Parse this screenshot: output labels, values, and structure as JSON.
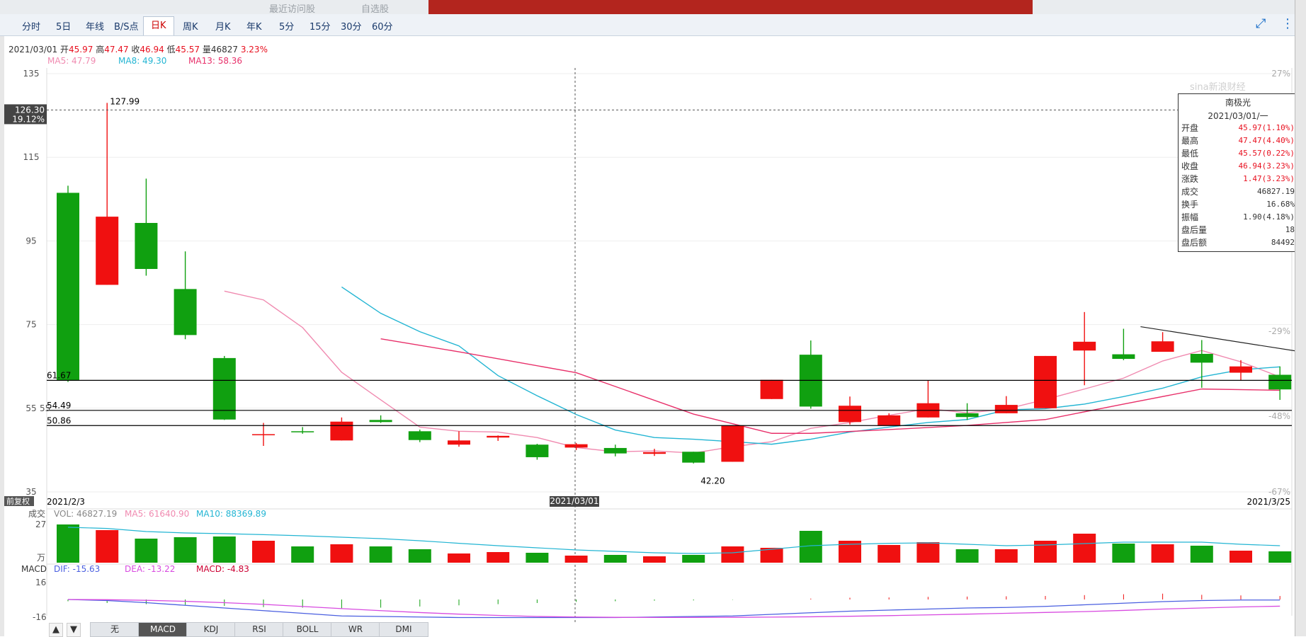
{
  "header": {
    "ghost_left": "最近访问股",
    "ghost_right": "自选股"
  },
  "tabs": [
    "分时",
    "5日",
    "年线",
    "B/S点",
    "日K",
    "周K",
    "月K",
    "年K",
    "5分",
    "15分",
    "30分",
    "60分"
  ],
  "active_tab": "日K",
  "icons": {
    "expand": "expand-icon",
    "more": "more-vertical-icon"
  },
  "info": {
    "date": "2021/03/01",
    "open_label": "开",
    "open": "45.97",
    "high_label": "高",
    "high": "47.47",
    "close_label": "收",
    "close": "46.94",
    "low_label": "低",
    "low": "45.57",
    "vol_label": "量",
    "vol": "46827",
    "chg": "3.23%"
  },
  "ma_text": {
    "ma5": "MA5: 47.79",
    "ma8": "MA8: 49.30",
    "ma13": "MA13: 58.36"
  },
  "colors": {
    "up": "#f01010",
    "down": "#10a010",
    "ma5": "#f08ab0",
    "ma8": "#23b5d3",
    "ma13": "#e8306a",
    "dif": "#4a5fe0",
    "dea": "#d84ae0"
  },
  "price_axis": {
    "left_ticks": [
      "135",
      "115",
      "95",
      "75",
      "55",
      "35"
    ],
    "right_ticks": [
      "27%",
      "-29%",
      "-48%",
      "-67%"
    ],
    "cursor_price": "126.30",
    "cursor_pct": "19.12%",
    "lines": [
      "61.67",
      "54.49",
      "50.86"
    ]
  },
  "watermark": "sina新浪财经",
  "tooltip": {
    "name": "南极光",
    "date": "2021/03/01/一",
    "rows": [
      {
        "label": "开盘",
        "value": "45.97(1.10%)",
        "red": true
      },
      {
        "label": "最高",
        "value": "47.47(4.40%)",
        "red": true
      },
      {
        "label": "最低",
        "value": "45.57(0.22%)",
        "red": true
      },
      {
        "label": "收盘",
        "value": "46.94(3.23%)",
        "red": true
      },
      {
        "label": "涨跌",
        "value": "1.47(3.23%)",
        "red": true
      },
      {
        "label": "成交",
        "value": "46827.19",
        "red": false
      },
      {
        "label": "换手",
        "value": "16.68%",
        "red": false
      },
      {
        "label": "振幅",
        "value": "1.90(4.18%)",
        "red": false
      },
      {
        "label": "盘后量",
        "value": "18",
        "red": false
      },
      {
        "label": "盘后额",
        "value": "84492",
        "red": false
      }
    ]
  },
  "annotations": {
    "max": "127.99",
    "min": "42.20"
  },
  "date_axis": {
    "left": "2021/2/3",
    "right": "2021/3/25",
    "cursor": "2021/03/01",
    "corner_label": "前复权"
  },
  "volume_panel": {
    "label": "成交",
    "vol_text": "VOL: 46827.19",
    "ma5_text": "MA5: 61640.90",
    "ma10_text": "MA10: 88369.89",
    "top_tick": "27",
    "unit": "万"
  },
  "macd_panel": {
    "label": "MACD",
    "dif_text": "DIF: -15.63",
    "dea_text": "DEA: -13.22",
    "macd_text": "MACD: -4.83",
    "ticks": [
      "16",
      "-16"
    ]
  },
  "subtabs": [
    "无",
    "MACD",
    "KDJ",
    "RSI",
    "BOLL",
    "WR",
    "DMI"
  ],
  "active_subtab": "MACD",
  "chart_data": {
    "type": "candlestick",
    "x": [
      "2021/2/3",
      "",
      "",
      "",
      "",
      "",
      "",
      "",
      "",
      "",
      "",
      "",
      "",
      "2021/03/01",
      "",
      "",
      "",
      "",
      "",
      "",
      "",
      "",
      "",
      "",
      "",
      "",
      "",
      "",
      "",
      "",
      "",
      "",
      "",
      "2021/3/25"
    ],
    "ohlc": [
      [
        106.5,
        108.2,
        61.3,
        61.7
      ],
      [
        84.5,
        128.0,
        84.5,
        100.8
      ],
      [
        99.3,
        109.9,
        86.7,
        88.3
      ],
      [
        83.5,
        92.5,
        71.5,
        72.5
      ],
      [
        67.0,
        67.5,
        52.2,
        52.3
      ],
      [
        48.8,
        51.5,
        46.0,
        48.8
      ],
      [
        49.5,
        50.5,
        48.9,
        49.3
      ],
      [
        47.3,
        52.8,
        47.3,
        51.8
      ],
      [
        52.2,
        53.3,
        51.5,
        51.7
      ],
      [
        49.5,
        49.9,
        46.9,
        47.4
      ],
      [
        46.3,
        49.5,
        45.8,
        47.3
      ],
      [
        48.0,
        48.5,
        47.2,
        48.4
      ],
      [
        46.3,
        46.5,
        42.7,
        43.3
      ],
      [
        45.6,
        46.7,
        45.0,
        46.4
      ],
      [
        45.5,
        46.3,
        43.5,
        44.2
      ],
      [
        44.1,
        45.3,
        43.6,
        44.5
      ],
      [
        44.6,
        44.6,
        41.8,
        42.0
      ],
      [
        42.2,
        50.9,
        42.2,
        50.9
      ],
      [
        57.2,
        61.8,
        57.2,
        61.8
      ],
      [
        67.8,
        71.2,
        54.9,
        55.4
      ],
      [
        51.7,
        57.8,
        51.1,
        55.6
      ],
      [
        50.9,
        53.8,
        50.9,
        53.3
      ],
      [
        52.8,
        61.6,
        52.8,
        56.2
      ],
      [
        53.8,
        56.2,
        52.2,
        52.9
      ],
      [
        53.8,
        57.9,
        53.8,
        55.8
      ],
      [
        55.0,
        67.5,
        55.0,
        67.5
      ],
      [
        68.8,
        78.0,
        60.5,
        70.9
      ],
      [
        67.9,
        74.0,
        66.5,
        66.8
      ],
      [
        68.5,
        73.2,
        68.5,
        71.0
      ],
      [
        68.0,
        71.3,
        59.9,
        65.9
      ],
      [
        63.5,
        66.5,
        61.6,
        65.0
      ],
      [
        63.0,
        65.0,
        57.0,
        59.5
      ]
    ],
    "ma5": [
      null,
      null,
      null,
      null,
      83.0,
      80.9,
      74.3,
      63.6,
      57.0,
      50.5,
      49.5,
      49.3,
      48.0,
      45.6,
      44.6,
      44.8,
      44.3,
      45.8,
      47.0,
      50.2,
      51.6,
      53.3,
      54.9,
      53.9,
      54.8,
      57.1,
      59.6,
      62.2,
      66.3,
      68.8,
      66.1,
      62.5
    ],
    "ma8": [
      null,
      null,
      null,
      null,
      null,
      null,
      null,
      84.0,
      77.7,
      73.3,
      69.9,
      62.8,
      58.0,
      53.5,
      49.8,
      48.0,
      47.6,
      47.0,
      46.4,
      47.6,
      49.3,
      50.5,
      51.6,
      52.3,
      54.6,
      54.9,
      56.0,
      57.8,
      59.8,
      62.5,
      64.2,
      64.9
    ],
    "ma13": [
      null,
      null,
      null,
      null,
      null,
      null,
      null,
      null,
      null,
      null,
      null,
      null,
      72.0,
      null,
      null,
      null,
      null,
      null,
      null,
      null,
      null,
      null,
      null,
      null,
      null,
      null,
      null,
      null,
      null,
      null,
      null,
      null
    ],
    "ma13_points": [
      [
        8,
        71.6
      ],
      [
        10,
        68.5
      ],
      [
        13,
        63.5
      ],
      [
        16,
        53.6
      ],
      [
        18,
        49.0
      ],
      [
        19,
        49.0
      ],
      [
        21,
        49.9
      ],
      [
        23,
        50.9
      ],
      [
        25,
        52.3
      ],
      [
        27,
        56.0
      ],
      [
        29,
        59.6
      ],
      [
        31,
        59.3
      ]
    ],
    "trendline": [
      [
        27,
        74.5
      ],
      [
        32,
        67.5
      ]
    ],
    "hlines": [
      61.67,
      54.49,
      50.86
    ],
    "ylim": [
      35,
      135
    ],
    "volume_wan": [
      27,
      23,
      17,
      18,
      18.5,
      15.5,
      11.5,
      13,
      11.5,
      9.5,
      6.5,
      7.5,
      7,
      5,
      5.5,
      4.5,
      5.5,
      11.5,
      10.5,
      22.5,
      15.5,
      12.5,
      14.5,
      9.5,
      9.5,
      15.5,
      20.5,
      13.5,
      13,
      12,
      8.5,
      8
    ],
    "volume_ma": [
      25.0,
      24.2,
      22.0,
      21.0,
      20.5,
      19.8,
      19.0,
      18.0,
      17.0,
      15.5,
      13.7,
      12.0,
      10.5,
      9.0,
      8.0,
      7.0,
      6.5,
      7.0,
      9.5,
      12.0,
      13.0,
      13.7,
      14.0,
      13.0,
      12.0,
      12.5,
      13.5,
      14.5,
      14.5,
      14.5,
      13.0,
      12.0
    ],
    "volume_ylim": [
      0,
      27
    ],
    "macd_hist": [
      -3,
      -6,
      -8,
      -9,
      -11,
      -13,
      -14,
      -15,
      -14,
      -12,
      -10,
      -8,
      -6,
      -4,
      -3,
      -2,
      -1.5,
      -0.5,
      0,
      1.5,
      3,
      3.5,
      4.5,
      5,
      5.5,
      6,
      7.5,
      9,
      10,
      8,
      7,
      6
    ],
    "dif": [
      0,
      -1,
      -3,
      -5.5,
      -8,
      -10.5,
      -13,
      -15.5,
      -16,
      -16.5,
      -17,
      -17,
      -17,
      -17,
      -17,
      -16.5,
      -16,
      -15.5,
      -14,
      -12.5,
      -11,
      -10,
      -9,
      -8,
      -7.5,
      -6.5,
      -5,
      -3.5,
      -2,
      -1,
      -0.5,
      -0.5
    ],
    "dea": [
      0,
      -0.2,
      -0.8,
      -1.7,
      -3,
      -4.6,
      -6.6,
      -8.6,
      -10.5,
      -12.3,
      -13.8,
      -15,
      -16,
      -16.5,
      -16.8,
      -16.9,
      -16.9,
      -16.8,
      -16.6,
      -16.3,
      -15.8,
      -15.2,
      -14.5,
      -13.8,
      -13,
      -12.2,
      -11.4,
      -10.3,
      -9,
      -8,
      -7,
      -6.3
    ],
    "macd_ylim": [
      -16,
      16
    ]
  }
}
